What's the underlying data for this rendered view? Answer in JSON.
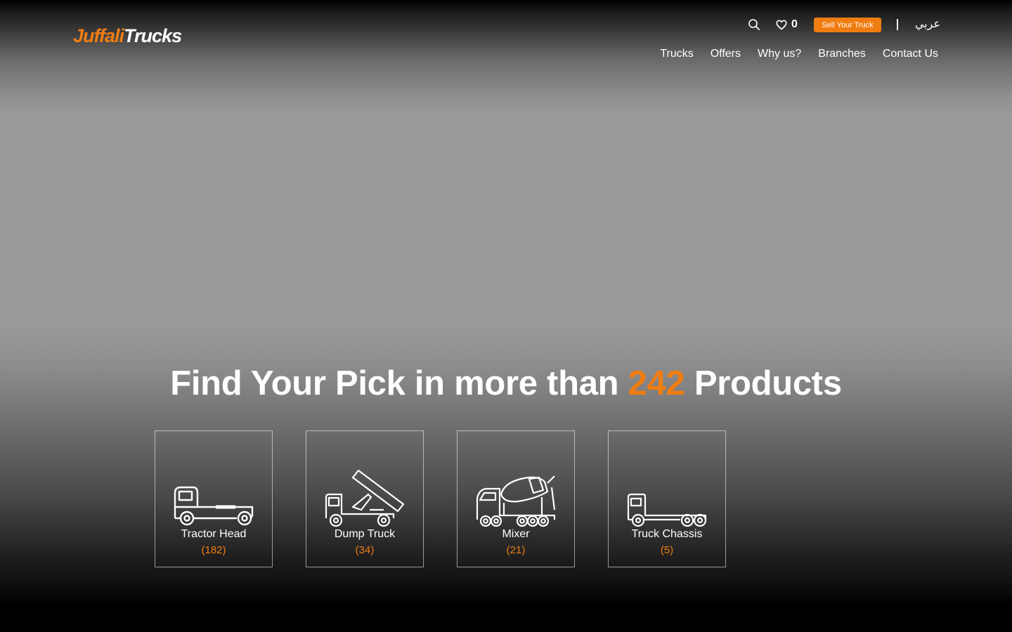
{
  "brand": {
    "logo_part1": "Juffali",
    "logo_part2": "Trucks",
    "accent": "#f07d11"
  },
  "header": {
    "wishlist_count": "0",
    "sell_button": "Sell Your Truck",
    "language": "عربي",
    "nav": [
      "Trucks",
      "Offers",
      "Why us?",
      "Branches",
      "Contact Us"
    ]
  },
  "hero": {
    "headline_before": "Find Your Pick in more than",
    "headline_count": "242",
    "headline_after": "Products"
  },
  "categories": [
    {
      "name": "Tractor Head",
      "count": "(182)",
      "icon": "tractor-head-icon"
    },
    {
      "name": "Dump Truck",
      "count": "(34)",
      "icon": "dump-truck-icon"
    },
    {
      "name": "Mixer",
      "count": "(21)",
      "icon": "mixer-truck-icon"
    },
    {
      "name": "Truck Chassis",
      "count": "(5)",
      "icon": "truck-chassis-icon"
    }
  ]
}
